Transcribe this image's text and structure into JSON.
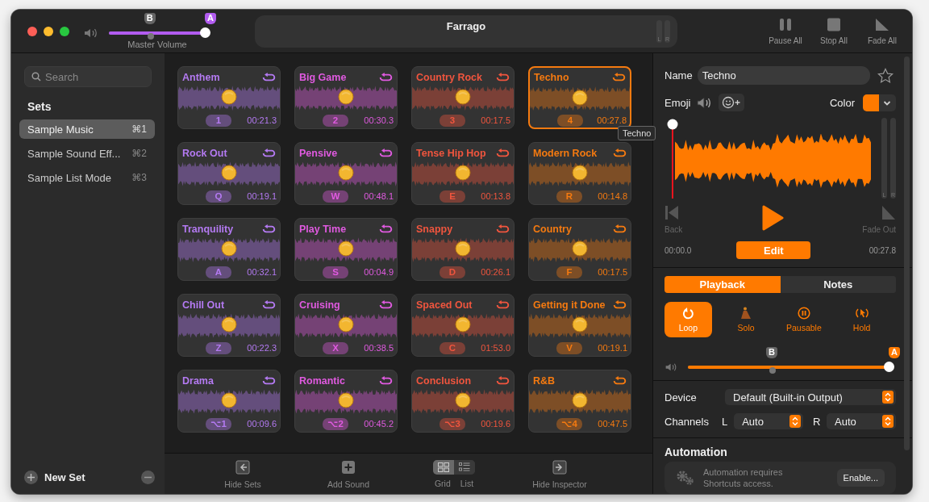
{
  "window": {
    "title": "Farrago"
  },
  "master_volume": {
    "label": "Master Volume",
    "marker_b": "B",
    "marker_a": "A",
    "level": 1
  },
  "title_meter": {
    "left": "L",
    "right": "R"
  },
  "toolbar": [
    {
      "label": "Pause All",
      "kind": "pause"
    },
    {
      "label": "Stop All",
      "kind": "stop"
    },
    {
      "label": "Fade All",
      "kind": "fade"
    }
  ],
  "sidebar": {
    "search": {
      "placeholder": "Search"
    },
    "heading": "Sets",
    "items": [
      {
        "label": "Sample Music",
        "shortcut": "⌘1",
        "selected": true
      },
      {
        "label": "Sample Sound Eff...",
        "shortcut": "⌘2",
        "selected": false
      },
      {
        "label": "Sample List Mode",
        "shortcut": "⌘3",
        "selected": false
      }
    ],
    "new_set": "New Set"
  },
  "tiles": [
    {
      "title": "Anthem",
      "key": "1",
      "time": "00:21.3",
      "color": "#b47af2",
      "selected": false
    },
    {
      "title": "Big Game",
      "key": "2",
      "time": "00:30.3",
      "color": "#e05ae0",
      "selected": false
    },
    {
      "title": "Country Rock",
      "key": "3",
      "time": "00:17.5",
      "color": "#f0553e",
      "selected": false
    },
    {
      "title": "Techno",
      "key": "4",
      "time": "00:27.8",
      "color": "#f57a10",
      "selected": true
    },
    {
      "title": "Rock Out",
      "key": "Q",
      "time": "00:19.1",
      "color": "#b47af2",
      "selected": false
    },
    {
      "title": "Pensive",
      "key": "W",
      "time": "00:48.1",
      "color": "#e05ae0",
      "selected": false
    },
    {
      "title": "Tense Hip Hop",
      "key": "E",
      "time": "00:13.8",
      "color": "#f0553e",
      "selected": false
    },
    {
      "title": "Modern Rock",
      "key": "R",
      "time": "00:14.8",
      "color": "#f57a10",
      "selected": false
    },
    {
      "title": "Tranquility",
      "key": "A",
      "time": "00:32.1",
      "color": "#b47af2",
      "selected": false
    },
    {
      "title": "Play Time",
      "key": "S",
      "time": "00:04.9",
      "color": "#e05ae0",
      "selected": false
    },
    {
      "title": "Snappy",
      "key": "D",
      "time": "00:26.1",
      "color": "#f0553e",
      "selected": false
    },
    {
      "title": "Country",
      "key": "F",
      "time": "00:17.5",
      "color": "#f57a10",
      "selected": false
    },
    {
      "title": "Chill Out",
      "key": "Z",
      "time": "00:22.3",
      "color": "#b47af2",
      "selected": false
    },
    {
      "title": "Cruising",
      "key": "X",
      "time": "00:38.5",
      "color": "#e05ae0",
      "selected": false
    },
    {
      "title": "Spaced Out",
      "key": "C",
      "time": "01:53.0",
      "color": "#f0553e",
      "selected": false
    },
    {
      "title": "Getting it Done",
      "key": "V",
      "time": "00:19.1",
      "color": "#f57a10",
      "selected": false
    },
    {
      "title": "Drama",
      "key": "⌥1",
      "time": "00:09.6",
      "color": "#b47af2",
      "selected": false
    },
    {
      "title": "Romantic",
      "key": "⌥2",
      "time": "00:45.2",
      "color": "#e05ae0",
      "selected": false
    },
    {
      "title": "Conclusion",
      "key": "⌥3",
      "time": "00:19.6",
      "color": "#f0553e",
      "selected": false
    },
    {
      "title": "R&B",
      "key": "⌥4",
      "time": "00:47.5",
      "color": "#f57a10",
      "selected": false
    }
  ],
  "tooltip": "Techno",
  "bottom_bar": {
    "hide_sets": "Hide Sets",
    "add_sound": "Add Sound",
    "views": [
      {
        "label": "Grid",
        "kind": "grid",
        "selected": true
      },
      {
        "label": "List",
        "kind": "list",
        "selected": false
      }
    ],
    "hide_inspector": "Hide Inspector"
  },
  "inspector": {
    "name_label": "Name",
    "name": "Techno",
    "favorite": false,
    "emoji_label": "Emoji",
    "color_label": "Color",
    "color": "#ff7a00",
    "meter": {
      "left": "L",
      "right": "R"
    },
    "back": "Back",
    "fade_out": "Fade Out",
    "start_time": "00:00.0",
    "edit": "Edit",
    "end_time": "00:27.8",
    "tabs": [
      {
        "label": "Playback",
        "selected": true
      },
      {
        "label": "Notes",
        "selected": false
      }
    ],
    "options": [
      {
        "label": "Loop",
        "kind": "loop",
        "on": true
      },
      {
        "label": "Solo",
        "kind": "solo",
        "on": false
      },
      {
        "label": "Pausable",
        "kind": "pausable",
        "on": false
      },
      {
        "label": "Hold",
        "kind": "hold",
        "on": false
      }
    ],
    "volume": {
      "marker_b": "B",
      "marker_a": "A",
      "level": 1
    },
    "device_label": "Device",
    "device": "Default (Built-in Output)",
    "channels_label": "Channels",
    "left_label": "L",
    "left": "Auto",
    "right_label": "R",
    "right": "Auto",
    "automation": {
      "heading": "Automation",
      "message": "Automation requires Shortcuts access.",
      "button": "Enable..."
    }
  }
}
